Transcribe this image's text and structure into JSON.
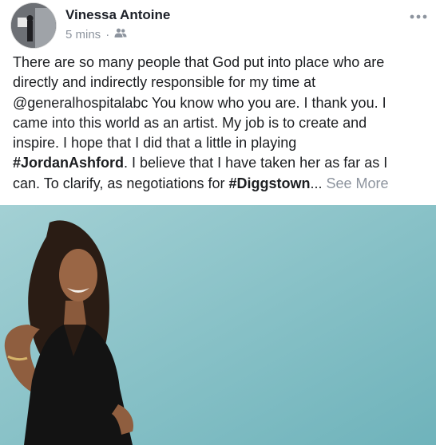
{
  "post": {
    "author": "Vinessa Antoine",
    "time": "5 mins",
    "separator": "·",
    "privacy_icon": "friends-icon",
    "more_icon": "more-options-icon",
    "lines": [
      "There are so many people that God put into place who are",
      "directly and indirectly responsible for my time at",
      "@generalhospitalabc You know who you are. I thank you. I",
      "came into this world as an artist. My job is to create and",
      "inspire. I hope that I did that a little in playing"
    ],
    "line6": {
      "hashtag": "#JordanAshford",
      "rest": ". I believe that I have taken her as far as I"
    },
    "line7": {
      "prefix": "can. To clarify, as negotiations for ",
      "hashtag": "#Diggstown",
      "ellipsis": "...",
      "see_more": "See More"
    }
  },
  "colors": {
    "text": "#1c1e21",
    "meta": "#8d949e",
    "photo_background": "#8ec4c9"
  }
}
